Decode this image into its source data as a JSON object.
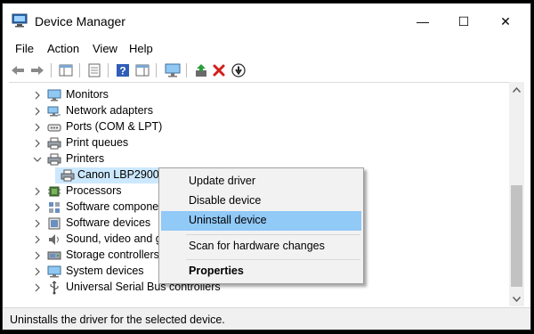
{
  "window": {
    "title": "Device Manager",
    "minimize_glyph": "—",
    "maximize_glyph": "☐",
    "close_glyph": "✕"
  },
  "menu": [
    "File",
    "Action",
    "View",
    "Help"
  ],
  "toolbar": {
    "icons": [
      "back-arrow-icon",
      "forward-arrow-icon",
      "show-hide-console-tree-icon",
      "properties-icon",
      "help-icon",
      "action-pane-icon",
      "monitor-icon",
      "update-driver-icon",
      "uninstall-icon",
      "disable-device-icon"
    ]
  },
  "tree": {
    "items": [
      {
        "label": "Monitors",
        "icon": "monitor-icon",
        "expanded": false
      },
      {
        "label": "Network adapters",
        "icon": "network-adapter-icon",
        "expanded": false
      },
      {
        "label": "Ports (COM & LPT)",
        "icon": "port-icon",
        "expanded": false
      },
      {
        "label": "Print queues",
        "icon": "printer-icon",
        "expanded": false
      },
      {
        "label": "Printers",
        "icon": "printer-icon",
        "expanded": true
      },
      {
        "label": "Canon LBP2900",
        "icon": "printer-icon",
        "child": true,
        "selected": true
      },
      {
        "label": "Processors",
        "icon": "processor-icon",
        "expanded": false
      },
      {
        "label": "Software componer",
        "icon": "software-component-icon",
        "expanded": false
      },
      {
        "label": "Software devices",
        "icon": "software-device-icon",
        "expanded": false
      },
      {
        "label": "Sound, video and ga",
        "icon": "speaker-icon",
        "expanded": false
      },
      {
        "label": "Storage controllers",
        "icon": "storage-controller-icon",
        "expanded": false
      },
      {
        "label": "System devices",
        "icon": "system-device-icon",
        "expanded": false
      },
      {
        "label": "Universal Serial Bus controllers",
        "icon": "usb-icon",
        "expanded": false
      }
    ]
  },
  "context_menu": {
    "items": [
      {
        "label": "Update driver"
      },
      {
        "label": "Disable device"
      },
      {
        "label": "Uninstall device",
        "highlighted": true
      },
      {
        "label": "Scan for hardware changes"
      },
      {
        "label": "Properties",
        "bold": true
      }
    ]
  },
  "status": {
    "text": "Uninstalls the driver for the selected device."
  },
  "colors": {
    "selection": "#cce8ff",
    "menu_highlight": "#91c9f7",
    "menu_bg": "#f2f2f2"
  }
}
